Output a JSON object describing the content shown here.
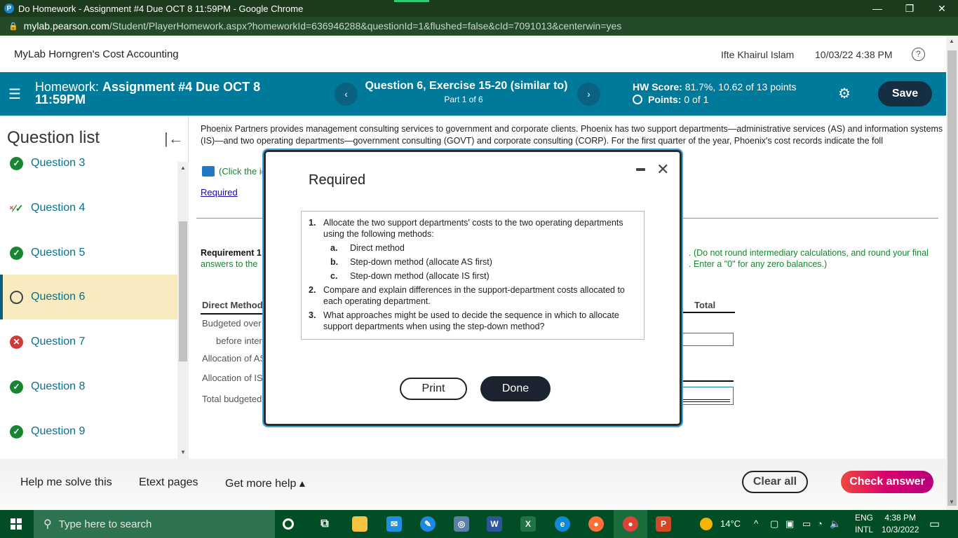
{
  "browser": {
    "title": "Do Homework - Assignment #4 Due OCT 8 11:59PM - Google Chrome",
    "url_host": "mylab.pearson.com",
    "url_path": "/Student/PlayerHomework.aspx?homeworkId=636946288&questionId=1&flushed=false&cId=7091013&centerwin=yes",
    "minimize": "—",
    "restore": "❐",
    "close": "✕"
  },
  "app": {
    "name": "MyLab Horngren's Cost Accounting",
    "user": "Ifte Khairul Islam",
    "datetime": "10/03/22 4:38 PM",
    "help": "?"
  },
  "homework": {
    "label": "Homework:",
    "name": "Assignment #4 Due OCT 8",
    "name_line2": "11:59PM",
    "question_title": "Question 6, Exercise 15-20 (similar to)",
    "part": "Part 1 of 6",
    "hw_score_label": "HW Score:",
    "hw_score_value": "81.7%, 10.62 of 13 points",
    "points_label": "Points:",
    "points_value": "0 of 1",
    "save_label": "Save",
    "prev": "‹",
    "next": "›"
  },
  "question_list": {
    "heading": "Question list",
    "items": [
      {
        "label": "Question 3",
        "status": "correct"
      },
      {
        "label": "Question 4",
        "status": "partial"
      },
      {
        "label": "Question 5",
        "status": "correct"
      },
      {
        "label": "Question 6",
        "status": "unanswered",
        "current": true
      },
      {
        "label": "Question 7",
        "status": "incorrect"
      },
      {
        "label": "Question 8",
        "status": "correct"
      },
      {
        "label": "Question 9",
        "status": "correct"
      }
    ]
  },
  "question": {
    "intro": "Phoenix Partners provides management consulting services to government and corporate clients. Phoenix has two support departments—administrative services (AS) and information systems (IS)—and two operating departments—government consulting (GOVT) and corporate consulting (CORP). For the first quarter of the year, Phoenix's cost records indicate the foll",
    "click_data": "(Click the ic",
    "required_link": "Required",
    "req1_bold": "Requirement 1",
    "req1_green": "answers to the",
    "req1_right_line1": ". (Do not round intermediary calculations, and round your final",
    "req1_right_line2": ". Enter a \"0\" for any zero balances.)",
    "table": {
      "header": "Direct Method",
      "total_header": "Total",
      "rows": [
        "Budgeted over",
        "before inter",
        "Allocation of AS",
        "Allocation of IS",
        "Total budgeted"
      ]
    }
  },
  "modal": {
    "title": "Required",
    "items": [
      {
        "num": "1.",
        "text": "Allocate the two support departments' costs to the two operating departments using the following methods:"
      },
      {
        "num": "a.",
        "text": "Direct method"
      },
      {
        "num": "b.",
        "text": "Step-down method (allocate AS first)"
      },
      {
        "num": "c.",
        "text": "Step-down method (allocate IS first)"
      },
      {
        "num": "2.",
        "text": "Compare and explain differences in the support-department costs allocated to each operating department."
      },
      {
        "num": "3.",
        "text": "What approaches might be used to decide the sequence in which to allocate support departments when using the step-down method?"
      }
    ],
    "print_label": "Print",
    "done_label": "Done",
    "close": "✕"
  },
  "footer": {
    "help_me": "Help me solve this",
    "etext": "Etext pages",
    "more_help": "Get more help ▴",
    "clear_all": "Clear all",
    "check_answer": "Check answer"
  },
  "taskbar": {
    "search_placeholder": "Type here to search",
    "weather": "14°C",
    "lang1": "ENG",
    "lang2": "INTL",
    "time": "4:38 PM",
    "date": "10/3/2022"
  }
}
